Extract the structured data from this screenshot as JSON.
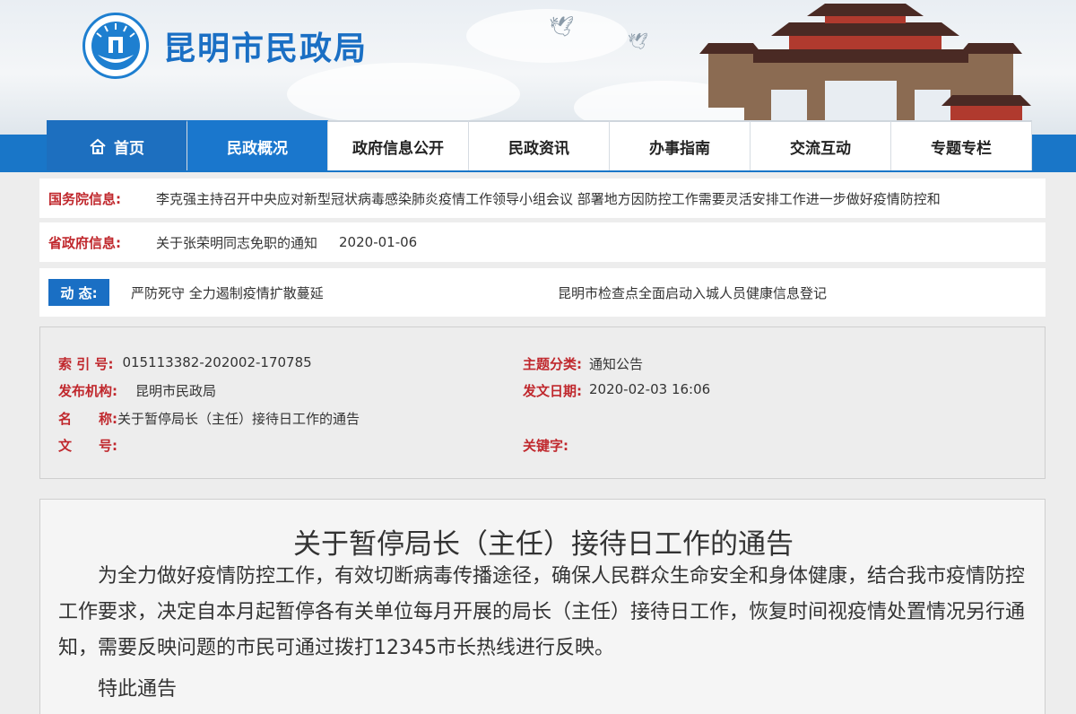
{
  "header": {
    "site_title": "昆明市民政局",
    "logo_icon": "civil-affairs-emblem-icon"
  },
  "nav": {
    "items": [
      {
        "label": "首页",
        "icon": "home-icon",
        "state": "home"
      },
      {
        "label": "民政概况",
        "state": "active"
      },
      {
        "label": "政府信息公开"
      },
      {
        "label": "民政资讯"
      },
      {
        "label": "办事指南"
      },
      {
        "label": "交流互动"
      },
      {
        "label": "专题专栏"
      }
    ]
  },
  "state_council": {
    "label": "国务院信息:",
    "text": "李克强主持召开中央应对新型冠状病毒感染肺炎疫情工作领导小组会议 部署地方因防控工作需要灵活安排工作进一步做好疫情防控和"
  },
  "provincial": {
    "label": "省政府信息:",
    "text": "关于张荣明同志免职的通知",
    "date": "2020-01-06"
  },
  "dynamics": {
    "label": "动 态:",
    "items": [
      "严防死守 全力遏制疫情扩散蔓延",
      "昆明市检查点全面启动入城人员健康信息登记"
    ]
  },
  "meta": {
    "index_no_label": "索 引 号:",
    "index_no": "015113382-202002-170785",
    "topic_label": "主题分类:",
    "topic": "通知公告",
    "publisher_label": "发布机构:",
    "publisher": "昆明市民政局",
    "date_label": "发文日期:",
    "date": "2020-02-03 16:06",
    "name_label_1": "名",
    "name_label_2": "称:",
    "name": "关于暂停局长（主任）接待日工作的通告",
    "docno_label_1": "文",
    "docno_label_2": "号:",
    "docno": "",
    "keywords_label": "关键字:",
    "keywords": ""
  },
  "article": {
    "title": "关于暂停局长（主任）接待日工作的通告",
    "paragraph1": "为全力做好疫情防控工作，有效切断病毒传播途径，确保人民群众生命安全和身体健康，结合我市疫情防控工作要求，决定自本月起暂停各有关单位每月开展的局长（主任）接待日工作，恢复时间视疫情处置情况另行通知，需要反映问题的市民可通过拨打12345市长热线进行反映。",
    "paragraph2": "特此通告"
  },
  "colors": {
    "brand_blue": "#1a6fc4",
    "label_red": "#c0282d",
    "nav_band": "#1976c8"
  }
}
